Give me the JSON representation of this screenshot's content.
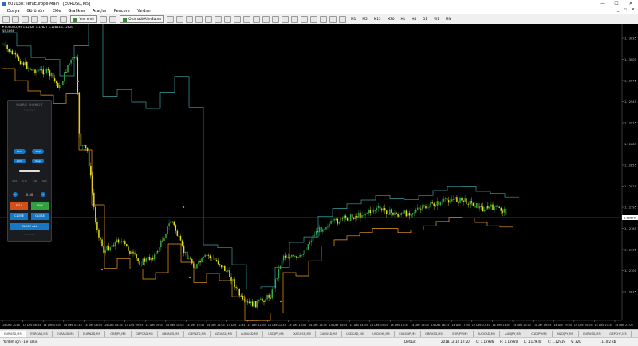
{
  "window": {
    "title": "601038: TeraEurope-Main - [EURUSD,M5]",
    "min_label": "—",
    "max_label": "☐",
    "close_label": "✕"
  },
  "menu": {
    "items": [
      "Dosya",
      "Görünüm",
      "Ekle",
      "Grafikler",
      "Araçlar",
      "Pencere",
      "Yardım"
    ],
    "mdi_controls": [
      "_",
      "▫",
      "×"
    ]
  },
  "toolbar": {
    "new_order_label": "Yeni emir",
    "autotrading_label": "OtomatikAlımSatım",
    "timeframes": [
      "M1",
      "M5",
      "M15",
      "M30",
      "H1",
      "H4",
      "D1",
      "W1",
      "MN"
    ]
  },
  "chart": {
    "symbol_label": "▾ EURUSD,M5  1.12827 1.12827 1.12813 1.12820",
    "indicator_label": "$5,1866",
    "current_price": "1.12820",
    "colors": {
      "background": "#000000",
      "bull": "#2eaa4a",
      "bear": "#e0e020",
      "upper_band": "#3aa0a0",
      "lower_band": "#f0a020",
      "price_line": "#808080"
    },
    "price_labels": [
      "1.13035",
      "1.13005",
      "1.12975",
      "1.12945",
      "1.12915",
      "1.12885",
      "1.12855",
      "1.12825",
      "1.12795",
      "1.12765",
      "1.12735",
      "1.12705",
      "1.12675"
    ],
    "time_labels": [
      "14 Dec 2018",
      "14 Dec 06:35",
      "14 Dec 07:05",
      "14 Dec 07:35",
      "14 Dec 08:05",
      "14 Dec 08:35",
      "14 Dec 09:05",
      "14 Dec 09:35",
      "14 Dec 10:05",
      "14 Dec 10:35",
      "14 Dec 11:05",
      "14 Dec 11:35",
      "14 Dec 12:05",
      "14 Dec 12:35",
      "14 Dec 13:05",
      "14 Dec 13:35",
      "14 Dec 14:05",
      "14 Dec 14:35",
      "14 Dec 15:05",
      "14 Dec 15:35",
      "14 Dec 16:05",
      "14 Dec 16:35",
      "14 Dec 17:05",
      "14 Dec 17:35",
      "14 Dec 18:05",
      "14 Dec 18:35",
      "14 Dec 19:05",
      "14 Dec 19:35",
      "14 Dec 20:05",
      "14 Dec 20:35",
      "14 Dec 21:05"
    ]
  },
  "panel": {
    "header": "HARE ROBOT",
    "subheader": "Trade Panel",
    "limit_label": "Limit",
    "stop_label": "Stop",
    "lot_options": [
      "0.01",
      "0.10",
      "1.00",
      "10.0"
    ],
    "lot_value": "0.30",
    "sell_label": "SELL",
    "buy_label": "BUY",
    "close_label": "CLOSE",
    "close_all_label": "CLOSE ALL",
    "footer": "Hare Robot"
  },
  "tabs": [
    "EURUSD,M5",
    "EURCAD,M5",
    "EURAUD,M5",
    "EURNZD,M5",
    "GBPJPY,M5",
    "GBPCAD,M5",
    "GBPAUD,M5",
    "GBPNZD,M5",
    "NZDUSD,M5",
    "AUDUSD,M5",
    "USDJPY,M5",
    "XAGUSD,M5",
    "XAUUSD,M5",
    "USDCAD,M5",
    "USDCHF,M5",
    "EURGBP,M5",
    "GBPUSD,M5",
    "EURJPY,M5",
    "AUDCAD,M5",
    "AUDJPY,M5",
    "CADJPY,M5",
    "NZDJPY,M5",
    "EURUSD,M5",
    "GBPCHF,M5"
  ],
  "active_tab_index": 0,
  "status": {
    "help": "Yardım için F1'e basın",
    "profile": "Default",
    "datetime": "2018.12.14 12:20",
    "open": "O: 1.12986",
    "high": "H: 1.12920",
    "low": "L: 1.12930",
    "close": "C: 1.12919",
    "volume": "V: 320",
    "traffic": "1110/2 kb"
  }
}
